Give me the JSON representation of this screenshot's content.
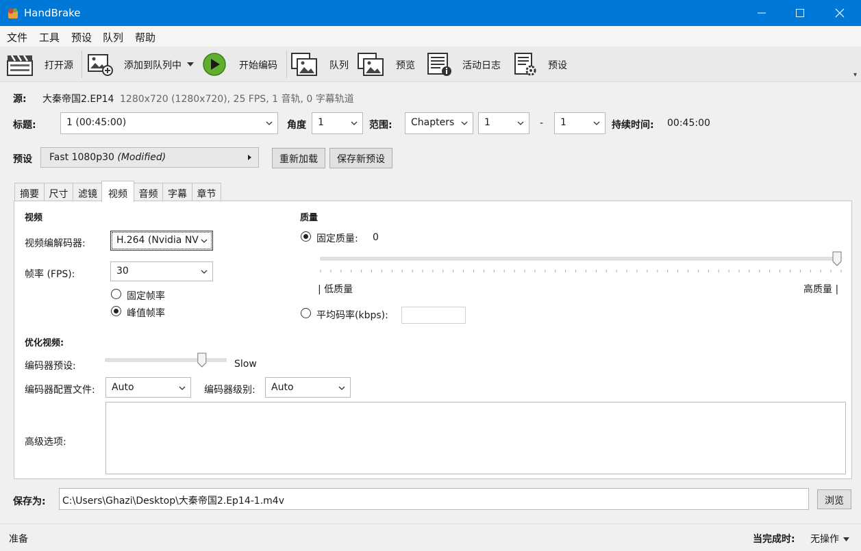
{
  "window": {
    "title": "HandBrake"
  },
  "menu": [
    {
      "label": "文件",
      "mnemonic": "F"
    },
    {
      "label": "工具",
      "mnemonic": "T"
    },
    {
      "label": "预设",
      "mnemonic": "P"
    },
    {
      "label": "队列",
      "mnemonic": "Q"
    },
    {
      "label": "帮助",
      "mnemonic": "H"
    }
  ],
  "toolbar": {
    "open_source": "打开源",
    "add_to_queue": "添加到队列中",
    "start_encode": "开始编码",
    "queue": "队列",
    "preview": "预览",
    "activity_log": "活动日志",
    "presets": "预设"
  },
  "source": {
    "label": "源:",
    "name": "大秦帝国2.EP14",
    "info": "1280x720 (1280x720), 25 FPS, 1 音轨, 0 字幕轨道"
  },
  "title_row": {
    "title_label": "标题:",
    "title_value": "1 (00:45:00)",
    "angle_label": "角度",
    "angle_value": "1",
    "range_label": "范围:",
    "range_type": "Chapters",
    "range_start": "1",
    "range_dash": "-",
    "range_end": "1",
    "duration_label": "持续时间:",
    "duration_value": "00:45:00"
  },
  "preset_row": {
    "label": "预设",
    "name": "Fast 1080p30",
    "modified": "(Modified)",
    "reload_button": "重新加载",
    "save_new_button": "保存新预设"
  },
  "tabs": [
    "摘要",
    "尺寸",
    "滤镜",
    "视频",
    "音频",
    "字幕",
    "章节"
  ],
  "active_tab": "视频",
  "video": {
    "section_title": "视频",
    "codec_label": "视频编解码器:",
    "codec_value": "H.264 (Nvidia NV",
    "fps_label": "帧率 (FPS):",
    "fps_value": "30",
    "constant_fps": "固定帧率",
    "peak_fps": "峰值帧率",
    "peak_fps_selected": true
  },
  "quality": {
    "section_title": "质量",
    "constant_quality_label": "固定质量:",
    "constant_quality_value": "0",
    "slider_fraction": 1.0,
    "low_label": "| 低质量",
    "high_label": "高质量 |",
    "avg_bitrate_label": "平均码率(kbps):",
    "avg_bitrate_value": ""
  },
  "optimize": {
    "section_title": "优化视频:",
    "encoder_preset_label": "编码器预设:",
    "encoder_preset_value": "Slow",
    "encoder_preset_fraction": 0.8,
    "profile_label": "编码器配置文件:",
    "profile_value": "Auto",
    "level_label": "编码器级别:",
    "level_value": "Auto",
    "advanced_label": "高级选项:",
    "advanced_value": ""
  },
  "save": {
    "label": "保存为:",
    "path": "C:\\Users\\Ghazi\\Desktop\\大秦帝国2.Ep14-1.m4v",
    "browse_button": "浏览"
  },
  "status": {
    "text": "准备",
    "when_done_label": "当完成时:",
    "when_done_value": "无操作"
  }
}
